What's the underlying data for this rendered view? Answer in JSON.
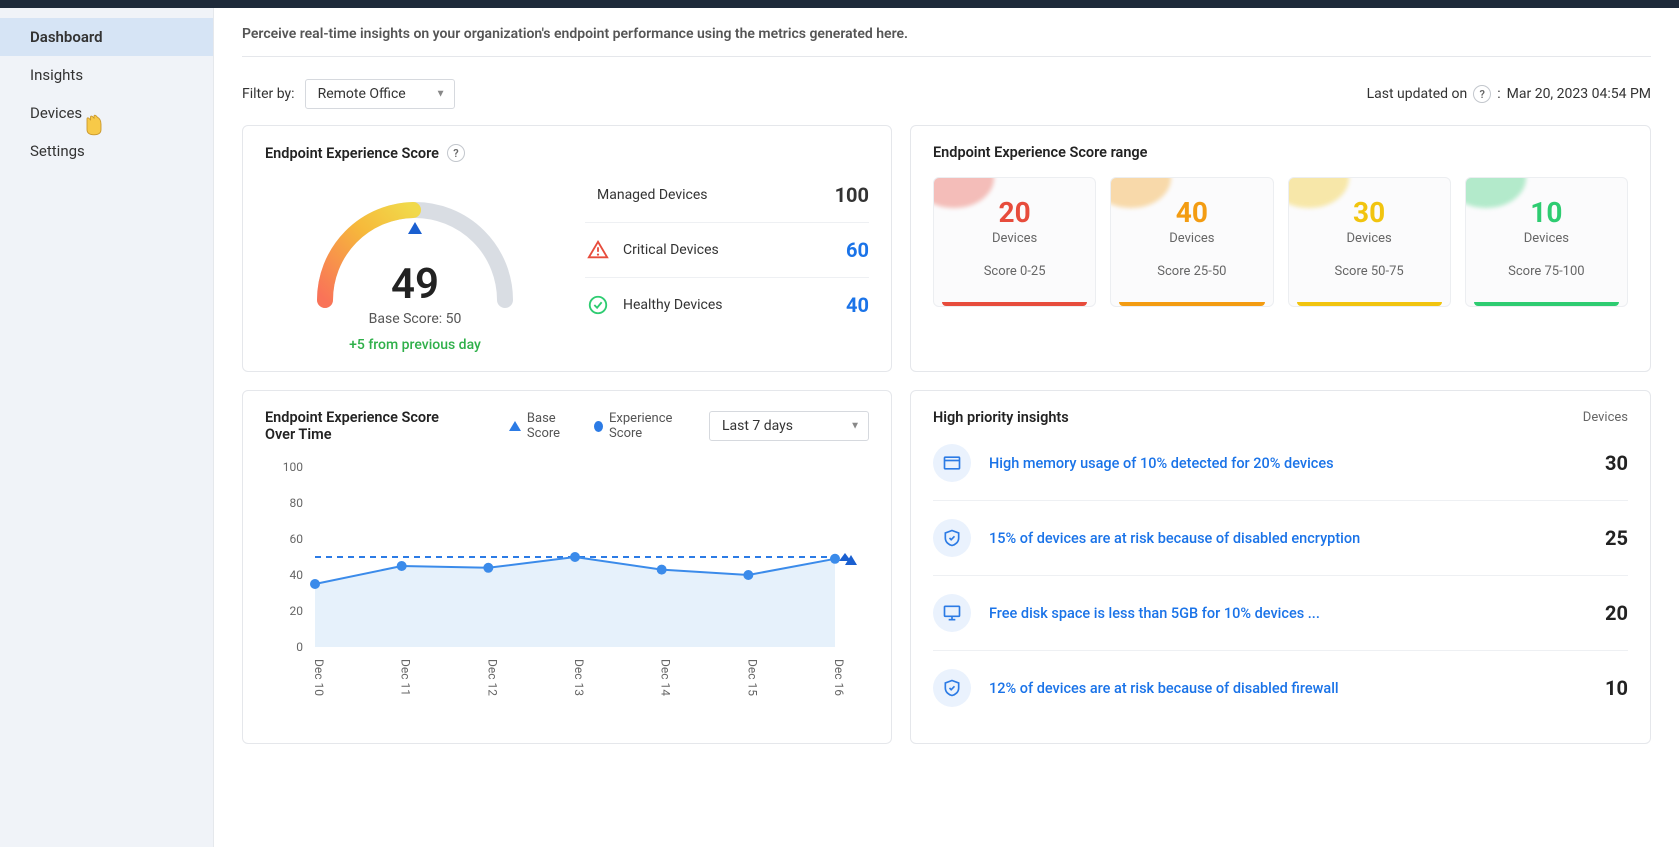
{
  "sidebar": {
    "items": [
      {
        "label": "Dashboard"
      },
      {
        "label": "Insights"
      },
      {
        "label": "Devices"
      },
      {
        "label": "Settings"
      }
    ]
  },
  "intro": "Perceive real-time insights on your organization's endpoint performance using the metrics generated here.",
  "filter": {
    "label": "Filter by:",
    "value": "Remote Office"
  },
  "last_updated": {
    "prefix": "Last updated on",
    "help": "?",
    "sep": ":",
    "timestamp": "Mar 20, 2023 04:54 PM"
  },
  "score": {
    "title": "Endpoint Experience Score",
    "help": "?",
    "value": "49",
    "base_label": "Base Score: 50",
    "delta": "+5 from previous day",
    "metrics": [
      {
        "label": "Managed Devices",
        "value": "100",
        "icon": "none",
        "link": false
      },
      {
        "label": "Critical Devices",
        "value": "60",
        "icon": "warning",
        "link": true
      },
      {
        "label": "Healthy Devices",
        "value": "40",
        "icon": "check",
        "link": true
      }
    ]
  },
  "range": {
    "title": "Endpoint Experience Score range",
    "devices_label": "Devices",
    "cards": [
      {
        "count": "20",
        "score": "Score 0-25",
        "color": "#e74c3c"
      },
      {
        "count": "40",
        "score": "Score 25-50",
        "color": "#f39c12"
      },
      {
        "count": "30",
        "score": "Score 50-75",
        "color": "#f1c40f"
      },
      {
        "count": "10",
        "score": "Score 75-100",
        "color": "#2ecc71"
      }
    ]
  },
  "overtime": {
    "title": "Endpoint Experience Score Over Time",
    "legend_base": "Base Score",
    "legend_exp": "Experience Score",
    "range_value": "Last 7 days"
  },
  "insights": {
    "title": "High priority insights",
    "col": "Devices",
    "rows": [
      {
        "text": "High memory usage of 10% detected for 20% devices",
        "count": "30",
        "icon": "window"
      },
      {
        "text": "15% of devices are at risk because of disabled encryption",
        "count": "25",
        "icon": "shield-check"
      },
      {
        "text": "Free disk space is less than 5GB for 10% devices ...",
        "count": "20",
        "icon": "monitor"
      },
      {
        "text": "12% of devices are at risk because of disabled firewall",
        "count": "10",
        "icon": "shield"
      }
    ]
  },
  "chart_data": {
    "type": "line",
    "categories": [
      "Dec 10",
      "Dec 11",
      "Dec 12",
      "Dec 13",
      "Dec 14",
      "Dec 15",
      "Dec 16"
    ],
    "series": [
      {
        "name": "Base Score",
        "values": [
          50,
          50,
          50,
          50,
          50,
          50,
          50
        ],
        "style": "dashed"
      },
      {
        "name": "Experience Score",
        "values": [
          35,
          45,
          44,
          50,
          43,
          40,
          49
        ],
        "style": "solid"
      }
    ],
    "ylabel": "",
    "xlabel": "",
    "ylim": [
      0,
      100
    ],
    "yticks": [
      0,
      20,
      40,
      60,
      80,
      100
    ]
  }
}
